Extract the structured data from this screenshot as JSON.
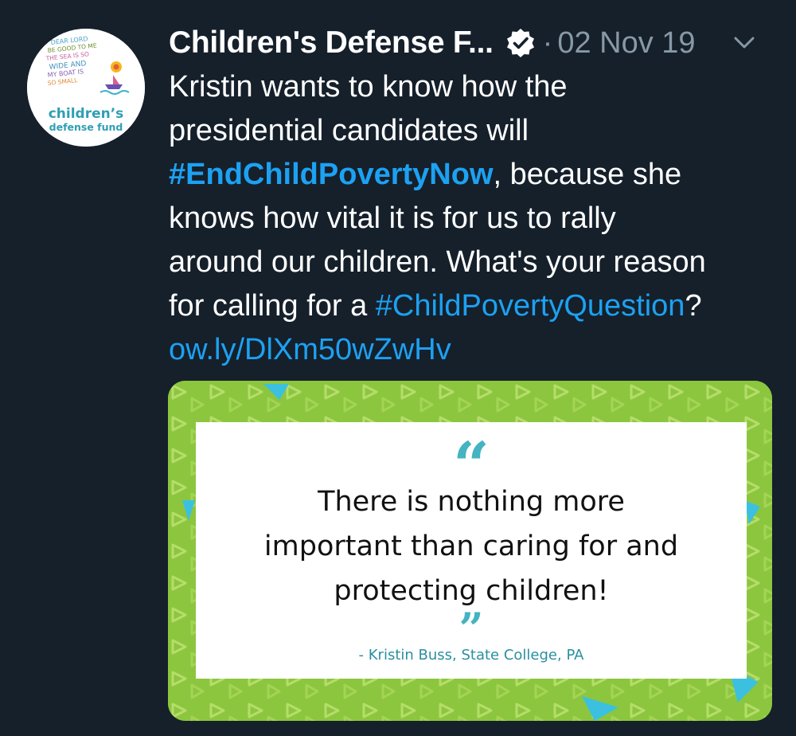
{
  "tweet": {
    "author_name": "Children's Defense F...",
    "verified_icon": "verified-check-icon",
    "separator": "·",
    "date": "02 Nov 19",
    "menu_icon": "chevron-down-icon",
    "body_lines": {
      "l1": "Kristin wants to know how the",
      "l2": "presidential candidates will",
      "l3_hashtag": "#EndChildPovertyNow",
      "l3_rest": ", because she",
      "l4": "knows how vital it is for us to rally",
      "l5": "around our children. What's your reason",
      "l6_start": "for calling for a ",
      "l6_hashtag": "#ChildPovertyQuestion",
      "l6_end": "?",
      "link": "ow.ly/DlXm50wZwHv"
    }
  },
  "avatar": {
    "logo_script": "DEAR LORD BE GOOD TO ME THE SEA IS SO WIDE AND MY BOAT IS SO SMALL",
    "logo_line1": "children's",
    "logo_line2": "defense fund"
  },
  "media": {
    "quote_open": "“",
    "quote_lines": [
      "There is nothing more",
      "important than caring for and",
      "protecting children!"
    ],
    "quote_close": "”",
    "attribution": "- Kristin Buss, State College, PA"
  },
  "colors": {
    "background": "#15202b",
    "link_blue": "#1da1f2",
    "muted": "#8899a6",
    "pattern_green": "#8cc63f",
    "quote_teal": "#44b3c2"
  }
}
